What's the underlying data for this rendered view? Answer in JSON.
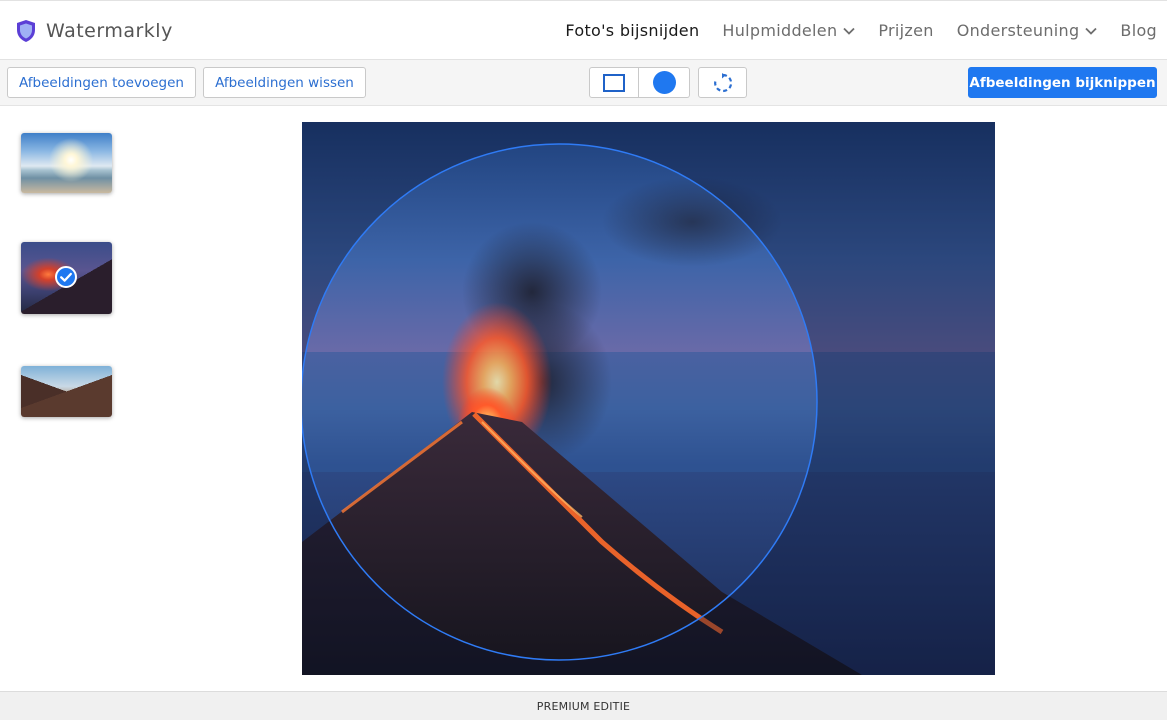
{
  "app": {
    "title": "Watermarkly",
    "logo_icon": "shield-icon",
    "brand_color": "#5b3fd6"
  },
  "nav": {
    "items": [
      {
        "label": "Foto's bijsnijden",
        "active": true
      },
      {
        "label": "Hulpmiddelen",
        "dropdown": true,
        "icon": "chevron-down-icon"
      },
      {
        "label": "Prijzen"
      },
      {
        "label": "Ondersteuning",
        "dropdown": true,
        "icon": "chevron-down-icon"
      },
      {
        "label": "Blog"
      }
    ]
  },
  "toolbar": {
    "add_images": "Afbeeldingen toevoegen",
    "clear_images": "Afbeeldingen wissen",
    "shape_rect_icon": "square-outline-icon",
    "shape_circle_icon": "circle-filled-icon",
    "rotate_icon": "rotate-icon",
    "selected_shape": "circle",
    "crop_images": "Afbeeldingen bijknippen",
    "accent_color": "#1f78f0"
  },
  "thumbnails": [
    {
      "subject": "sea-sunrise",
      "selected": false
    },
    {
      "subject": "volcano-eruption",
      "selected": true,
      "badge_icon": "check-circle-icon"
    },
    {
      "subject": "mountain-peak",
      "selected": false
    }
  ],
  "editor": {
    "image_subject": "erupting volcano at dusk",
    "crop_shape": "circle"
  },
  "footer": {
    "edition": "PREMIUM EDITIE"
  }
}
